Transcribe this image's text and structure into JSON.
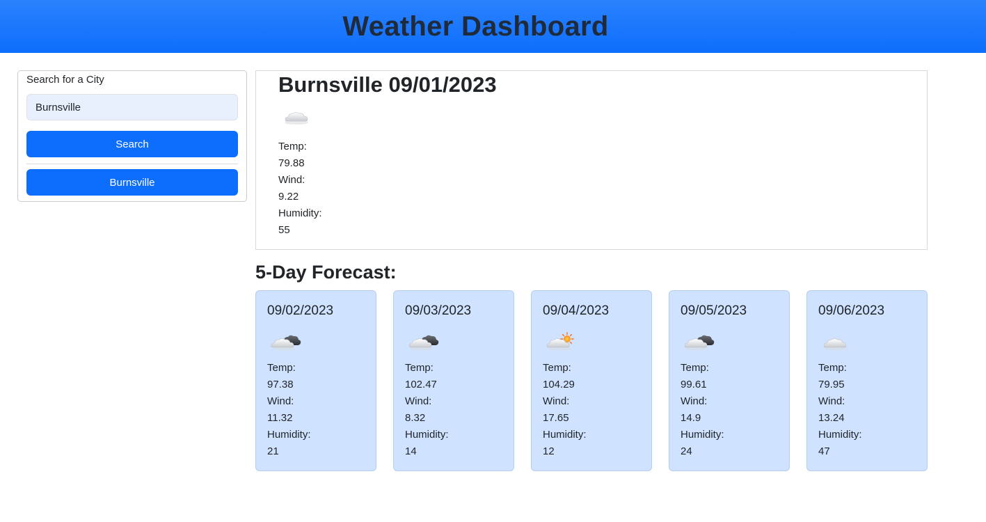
{
  "header": {
    "title": "Weather Dashboard"
  },
  "search": {
    "label": "Search for a City",
    "input_value": "Burnsville",
    "button_label": "Search",
    "history": [
      "Burnsville"
    ]
  },
  "current": {
    "title": "Burnsville 09/01/2023",
    "icon": "cloud-icon",
    "temp_label": "Temp:",
    "temp": "79.88",
    "wind_label": "Wind:",
    "wind": "9.22",
    "humidity_label": "Humidity:",
    "humidity": "55"
  },
  "forecast": {
    "heading": "5-Day Forecast:",
    "days": [
      {
        "date": "09/02/2023",
        "icon": "broken-clouds-icon",
        "temp_label": "Temp:",
        "temp": "97.38",
        "wind_label": "Wind:",
        "wind": "11.32",
        "humidity_label": "Humidity:",
        "humidity": "21"
      },
      {
        "date": "09/03/2023",
        "icon": "broken-clouds-icon",
        "temp_label": "Temp:",
        "temp": "102.47",
        "wind_label": "Wind:",
        "wind": "8.32",
        "humidity_label": "Humidity:",
        "humidity": "14"
      },
      {
        "date": "09/04/2023",
        "icon": "few-clouds-icon",
        "temp_label": "Temp:",
        "temp": "104.29",
        "wind_label": "Wind:",
        "wind": "17.65",
        "humidity_label": "Humidity:",
        "humidity": "12"
      },
      {
        "date": "09/05/2023",
        "icon": "broken-clouds-icon",
        "temp_label": "Temp:",
        "temp": "99.61",
        "wind_label": "Wind:",
        "wind": "14.9",
        "humidity_label": "Humidity:",
        "humidity": "24"
      },
      {
        "date": "09/06/2023",
        "icon": "cloud-icon",
        "temp_label": "Temp:",
        "temp": "79.95",
        "wind_label": "Wind:",
        "wind": "13.24",
        "humidity_label": "Humidity:",
        "humidity": "47"
      }
    ]
  },
  "colors": {
    "header_bg": "#0d6efd",
    "button_bg": "#0d6efd",
    "card_bg": "#cfe2ff",
    "input_bg": "#e8f0fe"
  }
}
